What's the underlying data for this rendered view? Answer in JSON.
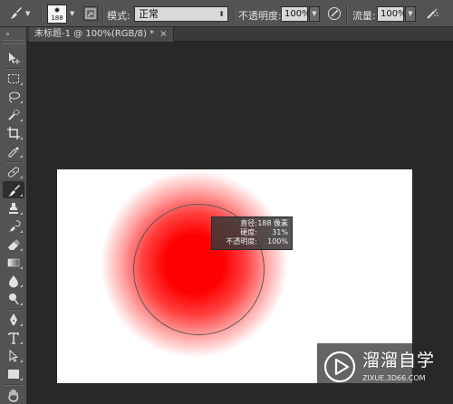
{
  "options_bar": {
    "brush_size": "188",
    "mode_label": "模式:",
    "mode_value": "正常",
    "opacity_label": "不透明度:",
    "opacity_value": "100%",
    "flow_label": "流量:",
    "flow_value": "100%"
  },
  "document_tab": {
    "title": "未标题-1 @ 100%(RGB/8) *",
    "close_glyph": "×"
  },
  "toolbar": {
    "collapse_glyph": "»",
    "tools": [
      {
        "name": "move",
        "icon": "move-icon"
      },
      {
        "name": "marquee",
        "icon": "rect-marquee-icon"
      },
      {
        "name": "lasso",
        "icon": "lasso-icon"
      },
      {
        "name": "quick-select",
        "icon": "quick-select-icon"
      },
      {
        "name": "crop",
        "icon": "crop-icon"
      },
      {
        "name": "eyedropper",
        "icon": "eyedropper-icon"
      },
      {
        "name": "healing",
        "icon": "bandage-icon"
      },
      {
        "name": "brush",
        "icon": "brush-icon",
        "active": true
      },
      {
        "name": "stamp",
        "icon": "stamp-icon"
      },
      {
        "name": "history-brush",
        "icon": "history-brush-icon"
      },
      {
        "name": "eraser",
        "icon": "eraser-icon"
      },
      {
        "name": "gradient",
        "icon": "gradient-icon"
      },
      {
        "name": "blur",
        "icon": "drop-icon"
      },
      {
        "name": "dodge",
        "icon": "dodge-icon"
      },
      {
        "name": "pen",
        "icon": "pen-icon"
      },
      {
        "name": "type",
        "icon": "type-icon"
      },
      {
        "name": "path-select",
        "icon": "path-select-icon"
      },
      {
        "name": "shape",
        "icon": "rectangle-icon"
      },
      {
        "name": "hand",
        "icon": "hand-icon"
      }
    ]
  },
  "canvas": {
    "brush_color": "#ff0000",
    "background": "#ffffff"
  },
  "hud": {
    "diameter_label": "直径:",
    "diameter_value": "188 像素",
    "hardness_label": "硬度:",
    "hardness_value": "31%",
    "opacity_label": "不透明度:",
    "opacity_value": "100%"
  },
  "watermark": {
    "title": "溜溜自学",
    "url": "ZIXUE.3D66.COM"
  }
}
